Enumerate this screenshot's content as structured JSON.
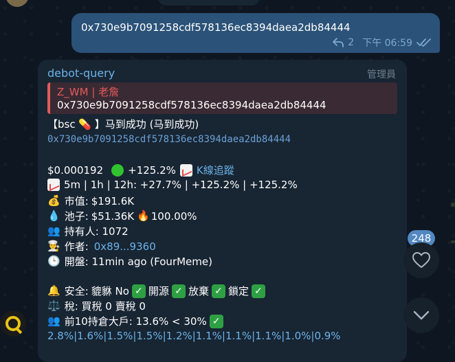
{
  "outgoing": {
    "text": "0x730e9b7091258cdf578136ec8394daea2db84444",
    "replies": "2",
    "time": "下午 06:59"
  },
  "incoming": {
    "sender": "debot-query",
    "role": "管理員",
    "reply": {
      "name": "Z_WM | 老詹",
      "text": "0x730e9b7091258cdf578136ec8394daea2db84444"
    },
    "title": "【bsc 💊 】马到成功 (马到成功)",
    "address": "0x730e9b7091258cdf578136ec8394daea2db84444",
    "price": "$0.000192",
    "change": "+125.2%",
    "kline_link": "K線追蹤",
    "timeframes": "5m | 1h | 12h: +27.7%  | +125.2%  | +125.2%",
    "market_cap_label": "市值:",
    "market_cap": "$191.6K",
    "pool_label": "池子:",
    "pool": "$51.36K",
    "pool_pct": "100.00%",
    "holders": "持有人: 1072",
    "author_label": "作者:",
    "author": "0x89...9360",
    "opened": "開盤: 11min ago (FourMeme)",
    "security_label": "安全:",
    "honeypot": "貔貅 No",
    "open_source": "開源",
    "renounced": "放棄",
    "locked": "鎖定",
    "tax": "稅: 買稅 0 賣稅 0",
    "top10": "前10持倉大戶: 13.6% < 30%",
    "top_holders": "2.8%|1.6%|1.5%|1.5%|1.2%|1.1%|1.1%|1.1%|1.0%|0.9%"
  },
  "reaction_count": "248",
  "icons": {
    "reply": "reply-arrow-icon",
    "read": "double-check-icon",
    "heart": "heart-icon",
    "down": "chevron-down-icon"
  }
}
